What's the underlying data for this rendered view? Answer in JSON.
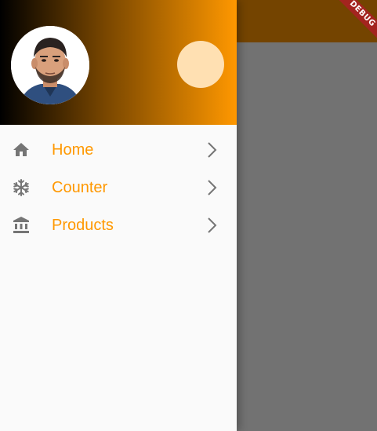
{
  "app": {
    "debug_banner": "DEBUG"
  },
  "drawer": {
    "header": {
      "avatar": "profile-photo",
      "secondary_avatar_color": "#ffe0b2",
      "gradient": [
        "#000000",
        "#ff9800"
      ]
    },
    "items": [
      {
        "label": "Home",
        "icon": "home-icon"
      },
      {
        "label": "Counter",
        "icon": "snowflake-icon"
      },
      {
        "label": "Products",
        "icon": "bank-icon"
      }
    ]
  },
  "colors": {
    "accent": "#ff9800",
    "icon": "#757575",
    "drawer_bg": "#fafafa",
    "appbar": "#744400",
    "scrim": "#727272"
  }
}
